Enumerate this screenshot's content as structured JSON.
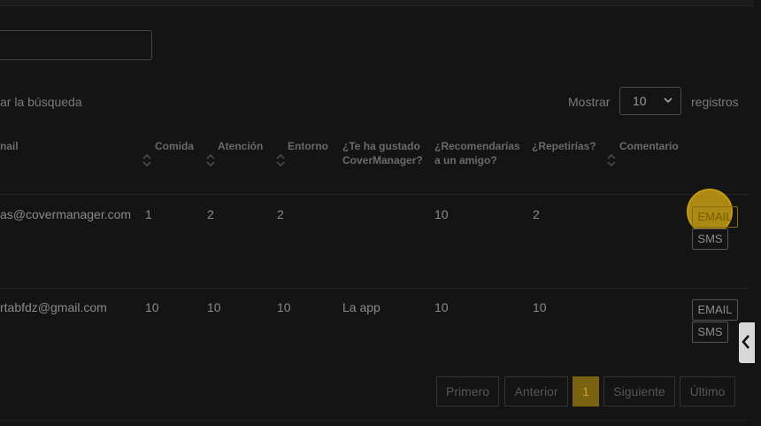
{
  "search": {
    "hint": "ar la búsqueda",
    "value": ""
  },
  "length": {
    "show_label": "Mostrar",
    "selected": "10",
    "records_label": "registros"
  },
  "columns": {
    "email": "nail",
    "comida": "Comida",
    "atencion": "Atención",
    "entorno": "Entorno",
    "gustado_1": "¿Te ha gustado",
    "gustado_2": "CoverManager?",
    "recomendarias_1": "¿Recomendarías",
    "recomendarias_2": "a un amigo?",
    "repetirias": "¿Repetirías?",
    "comentario": "Comentario"
  },
  "rows": [
    {
      "email": "as@covermanager.com",
      "comida": "1",
      "atencion": "2",
      "entorno": "2",
      "gustado": "",
      "recomendarias": "10",
      "repetirias": "2",
      "comentario": ""
    },
    {
      "email": "rtabfdz@gmail.com",
      "comida": "10",
      "atencion": "10",
      "entorno": "10",
      "gustado": "La app",
      "recomendarias": "10",
      "repetirias": "10",
      "comentario": ""
    }
  ],
  "actions": {
    "email": "EMAIL",
    "sms": "SMS"
  },
  "pagination": {
    "first": "Primero",
    "prev": "Anterior",
    "current": "1",
    "next": "Siguiente",
    "last": "Último"
  },
  "colors": {
    "background": "#141414",
    "accent": "#e8b714",
    "active_page": "#7a6310"
  },
  "icons": {
    "sort": "sort-both-icon",
    "chevron": "chevron-down-icon",
    "side": "chevron-left-icon"
  }
}
